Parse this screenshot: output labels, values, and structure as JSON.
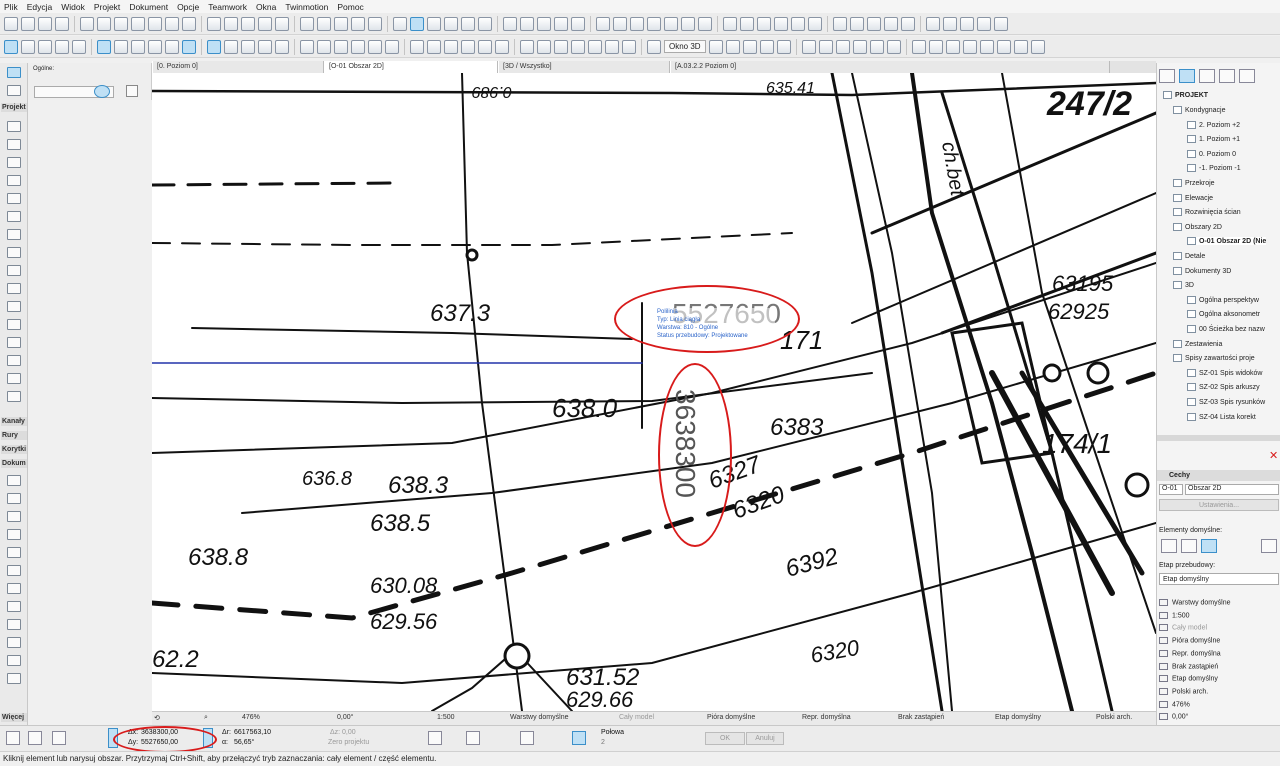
{
  "menu": [
    "Plik",
    "Edycja",
    "Widok",
    "Projekt",
    "Dokument",
    "Opcje",
    "Teamwork",
    "Okna",
    "Twinmotion",
    "Pomoc"
  ],
  "toolbar2": {
    "okno3d": "Okno 3D"
  },
  "left_panel": {
    "ogolne": "Ogólne:",
    "projekt": "Projekt",
    "kanaly": "Kanały",
    "rury": "Rury",
    "korytki": "Korytki",
    "dokum": "Dokum",
    "wiecej": "Więcej"
  },
  "tabs": [
    "[0. Poziom 0]",
    "[O-01 Obszar 2D]",
    "[3D / Wszystko]",
    "[A.03.2.2 Poziom 0]"
  ],
  "drawing": {
    "labels": [
      "0.989",
      "635.41",
      "247/2",
      "637.3",
      "5527650",
      "638.0",
      "3638300",
      "636.8",
      "638.3",
      "638.5",
      "6383",
      "6327",
      "6320",
      "638.8",
      "630.08",
      "629.56",
      "6392",
      "631.52",
      "629.66",
      "6320",
      "63195",
      "62925",
      "174/1",
      "171",
      "ch.bet.",
      "62.2"
    ],
    "colors": {
      "ink": "#111111",
      "selection": "#2233aa",
      "annotation": "#d81b1b"
    }
  },
  "tooltip": {
    "title": "Polilinia",
    "line1": "Typ: Linia ciągła",
    "line2": "Warstwa: 810 - Ogólne",
    "line3": "Status przebudowy: Projektowane"
  },
  "navigator": {
    "root": "PROJEKT",
    "items": [
      "Kondygnacje",
      "2. Poziom +2",
      "1. Poziom +1",
      "0. Poziom 0",
      "-1. Poziom -1",
      "Przekroje",
      "Elewacje",
      "Rozwinięcia ścian",
      "Obszary 2D",
      "O-01 Obszar 2D (Nie",
      "Detale",
      "Dokumenty 3D",
      "3D",
      "Ogólna perspektyw",
      "Ogólna aksonometr",
      "00 Ścieżka bez nazw",
      "Zestawienia",
      "Spisy zawartości proje",
      "SZ-01 Spis widoków",
      "SZ-02 Spis arkuszy",
      "SZ-03 Spis rysunków",
      "SZ-04 Lista korekt"
    ]
  },
  "properties": {
    "header": "Cechy",
    "id": "O-01",
    "name": "Obszar 2D",
    "settings": "Ustawienia...",
    "defaults_header": "Elementy domyślne:",
    "phase_label": "Etap przebudowy:",
    "phase_value": "Etap domyślny",
    "list": [
      "Warstwy domyślne",
      "1:500",
      "Cały model",
      "Pióra domyślne",
      "Repr. domyślna",
      "Brak zastąpień",
      "Etap domyślny",
      "Polski arch.",
      "476%",
      "0,00°"
    ]
  },
  "quickbar": {
    "zoom": "476%",
    "angle": "0,00°",
    "scale": "1:500",
    "layers": "Warstwy domyślne",
    "model": "Cały model",
    "pens": "Pióra domyślne",
    "repr": "Repr. domyślna",
    "override": "Brak zastąpień",
    "phase": "Etap domyślny",
    "std": "Polski arch."
  },
  "coords": {
    "dx_label": "Δx:",
    "dx": "3638300,00",
    "dy_label": "Δy:",
    "dy": "5527650,00",
    "ar_label": "Δr:",
    "ar": "6617563,10",
    "a_label": "α:",
    "a": "56,65°",
    "dz_label": "Δz:",
    "dz": "0,00",
    "zero": "Zero projektu",
    "snap_label": "Połowa",
    "snap_num": "2",
    "ok": "OK",
    "cancel": "Anuluj"
  },
  "status": "Kliknij element lub narysuj obszar. Przytrzymaj Ctrl+Shift, aby przełączyć tryb zaznaczania: cały element / część elementu."
}
